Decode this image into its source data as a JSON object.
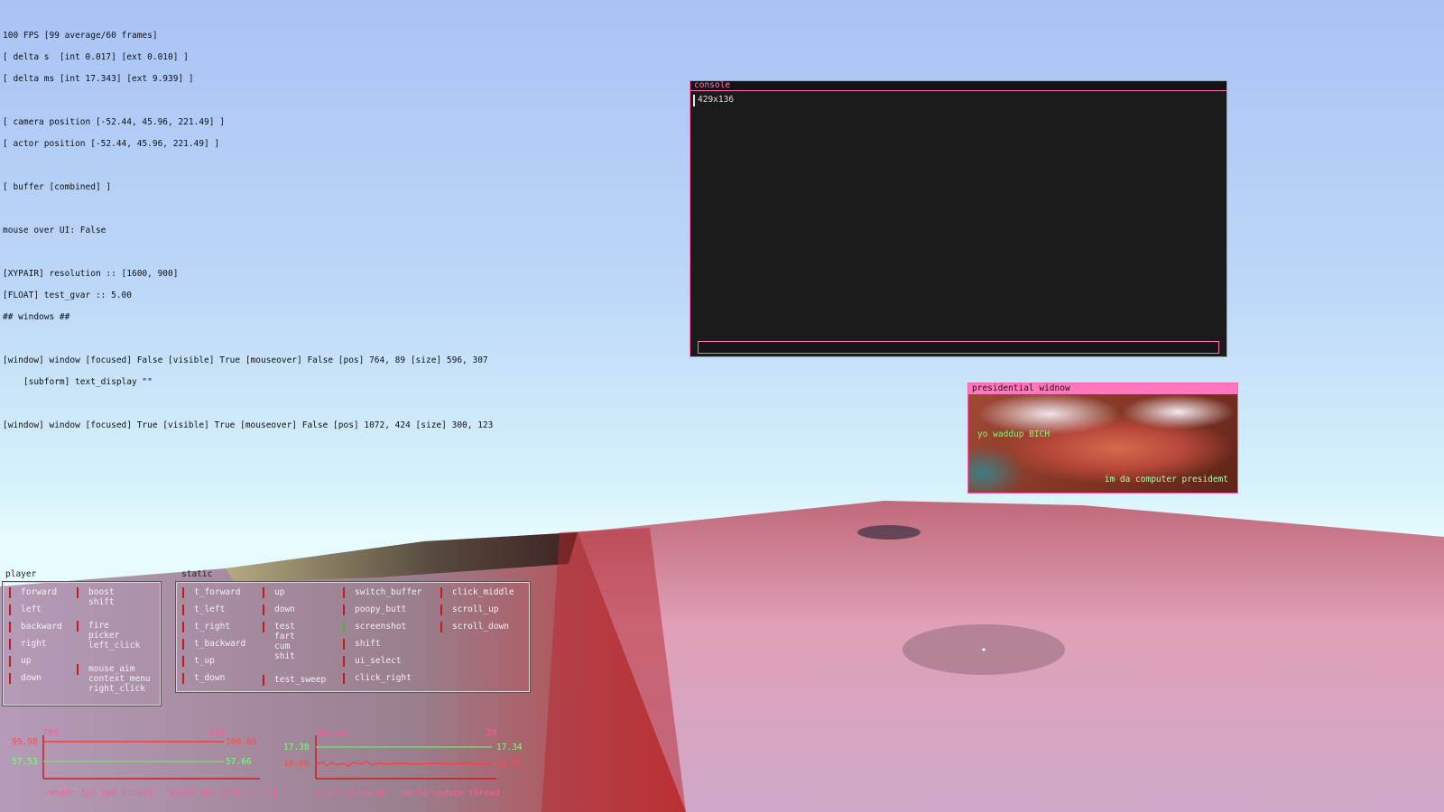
{
  "hud": {
    "fps_line": "100 FPS [99 average/60 frames]",
    "delta_s": "[ delta s  [int 0.017] [ext 0.010] ]",
    "delta_ms": "[ delta ms [int 17.343] [ext 9.939] ]",
    "camera": "[ camera position [-52.44, 45.96, 221.49] ]",
    "actor": "[ actor position [-52.44, 45.96, 221.49] ]",
    "buffer": "[ buffer [combined] ]",
    "mouse_over": "mouse over UI: False",
    "resolution": "[XYPAIR] resolution :: [1600, 900]",
    "test_gvar": "[FLOAT] test_gvar :: 5.00",
    "windows_header": "## windows ##",
    "window1": "[window] window [focused] False [visible] True [mouseover] False [pos] 764, 89 [size] 596, 307",
    "subform": "    [subform] text_display \"\"",
    "window2": "[window] window [focused] True [visible] True [mouseover] False [pos] 1072, 424 [size] 300, 123"
  },
  "console": {
    "title": "console",
    "line": "429x136",
    "input_value": ""
  },
  "pres_window": {
    "title": "presidential widnow",
    "text1": "yo waddup BICH",
    "text2": "im da computer presidemt"
  },
  "player_panel": {
    "title": "player",
    "col1": [
      "forward",
      "left",
      "backward",
      "right",
      "up",
      "down"
    ],
    "col2": [
      "boost\nshift",
      "fire\npicker\nleft_click",
      "mouse_aim\ncontext_menu\nright_click"
    ]
  },
  "static_panel": {
    "title": "static",
    "col1": [
      "t_forward",
      "t_left",
      "t_right",
      "t_backward",
      "t_up",
      "t_down"
    ],
    "col2": [
      "up",
      "down",
      "test\nfart\ncum\nshit",
      "test_sweep"
    ],
    "col3": [
      "switch_buffer",
      "poopy_butt",
      "screenshot",
      "shift",
      "ui_select",
      "click_right"
    ],
    "col4": [
      "click_middle",
      "scroll_up",
      "scroll_down"
    ]
  },
  "fps_graph": {
    "title": "FPS",
    "max_label": "101",
    "left_top": "99.98",
    "left_bottom": "57.53",
    "right_top": "100.00",
    "right_bottom": "57.66",
    "legend_a": "render fps [60 ticks]",
    "legend_b": "world fps [290 ticks]"
  },
  "delta_graph": {
    "title": "deltas",
    "max_label": "20",
    "left_top": "17.38",
    "left_bottom": "10.00",
    "right_top": "17.34",
    "right_bottom": "10.70",
    "legend_a": "clock delta ms",
    "legend_b": "world update thread"
  },
  "colors": {
    "accent_pink": "#ff70b4",
    "key_off": "#c21b1b",
    "key_on": "#3fb83f",
    "graph_red": "#ff4b4b",
    "graph_green": "#7cff7c"
  }
}
